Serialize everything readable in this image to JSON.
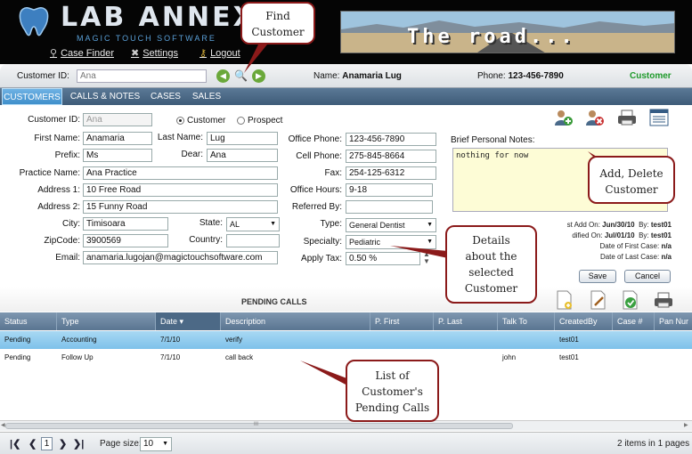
{
  "app": {
    "logo": "LAB ANNEX",
    "tagline": "MAGIC TOUCH SOFTWARE",
    "nav": [
      "Case Finder",
      "Settings",
      "Logout"
    ],
    "banner_text": "The   road..."
  },
  "idbar": {
    "customer_id_label": "Customer ID:",
    "customer_id_value": "Ana",
    "name_label": "Name:",
    "name_value": "Anamaria Lug",
    "phone_label": "Phone:",
    "phone_value": "123-456-7890",
    "status": "Customer"
  },
  "tabs": [
    "CUSTOMERS",
    "CALLS & NOTES",
    "CASES",
    "SALES"
  ],
  "form": {
    "customer_id": {
      "label": "Customer ID:",
      "value": "Ana"
    },
    "type_radio": {
      "customer": "Customer",
      "prospect": "Prospect"
    },
    "first_name": {
      "label": "First Name:",
      "value": "Anamaria"
    },
    "last_name": {
      "label": "Last Name:",
      "value": "Lug"
    },
    "prefix": {
      "label": "Prefix:",
      "value": "Ms"
    },
    "dear": {
      "label": "Dear:",
      "value": "Ana"
    },
    "practice_name": {
      "label": "Practice Name:",
      "value": "Ana Practice"
    },
    "address1": {
      "label": "Address 1:",
      "value": "10 Free Road"
    },
    "address2": {
      "label": "Address 2:",
      "value": "15 Funny Road"
    },
    "city": {
      "label": "City:",
      "value": "Timisoara"
    },
    "state": {
      "label": "State:",
      "value": "AL"
    },
    "zipcode": {
      "label": "ZipCode:",
      "value": "3900569"
    },
    "country": {
      "label": "Country:",
      "value": ""
    },
    "email": {
      "label": "Email:",
      "value": "anamaria.lugojan@magictouchsoftware.com"
    },
    "office_phone": {
      "label": "Office Phone:",
      "value": "123-456-7890"
    },
    "cell_phone": {
      "label": "Cell Phone:",
      "value": "275-845-8664"
    },
    "fax": {
      "label": "Fax:",
      "value": "254-125-6312"
    },
    "office_hours": {
      "label": "Office Hours:",
      "value": "9-18"
    },
    "referred_by": {
      "label": "Referred By:",
      "value": ""
    },
    "type": {
      "label": "Type:",
      "value": "General Dentist"
    },
    "specialty": {
      "label": "Specialty:",
      "value": "Pediatric"
    },
    "apply_tax": {
      "label": "Apply Tax:",
      "value": "0.50 %"
    },
    "notes_label": "Brief Personal Notes:",
    "notes_value": "nothing for now",
    "meta": [
      {
        "label": "st Add On:",
        "date": "Jun/30/10",
        "by_label": "By:",
        "by": "test01"
      },
      {
        "label": "dified On:",
        "date": "Jul/01/10",
        "by_label": "By:",
        "by": "test01"
      },
      {
        "label": "Date of First Case:",
        "date": "n/a",
        "by_label": "",
        "by": ""
      },
      {
        "label": "Date of Last Case:",
        "date": "n/a",
        "by_label": "",
        "by": ""
      }
    ],
    "save": "Save",
    "cancel": "Cancel"
  },
  "pending_calls": {
    "title": "PENDING CALLS",
    "columns": [
      "Status",
      "Type",
      "Date ▾",
      "Description",
      "P. First",
      "P. Last",
      "Talk To",
      "CreatedBy",
      "Case #",
      "Pan Nur"
    ],
    "rows": [
      [
        "Pending",
        "Accounting",
        "7/1/10",
        "verify",
        "",
        "",
        "",
        "test01",
        "",
        ""
      ],
      [
        "Pending",
        "Follow Up",
        "7/1/10",
        "call back",
        "",
        "",
        "john",
        "test01",
        "",
        ""
      ]
    ],
    "scroll_center": "III"
  },
  "pager": {
    "current_page": "1",
    "page_size_label": "Page size:",
    "page_size": "10",
    "summary": "2 items in 1 pages"
  },
  "callouts": {
    "find": [
      "Find",
      "Customer"
    ],
    "add_delete": [
      "Add, Delete",
      "Customer"
    ],
    "details": [
      "Details",
      "about the",
      "selected",
      "Customer"
    ],
    "list": [
      "List of",
      "Customer's",
      "Pending Calls"
    ]
  },
  "colors": {
    "header_bg": "#050505",
    "tab_active": "#3f8fcb",
    "status_green": "#1e9a2a",
    "callout_border": "#8b1a1a",
    "notes_bg": "#fdfcd6"
  }
}
